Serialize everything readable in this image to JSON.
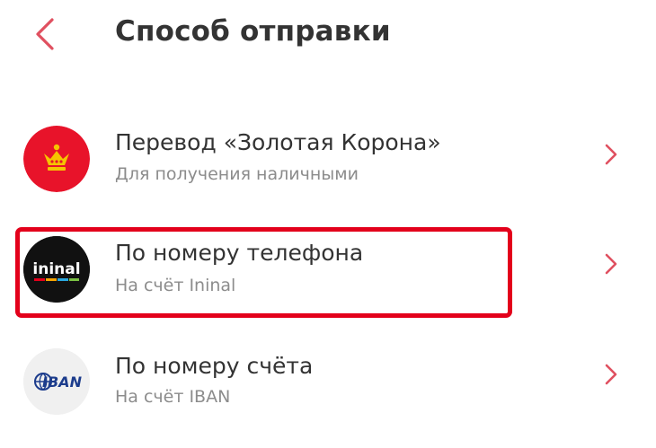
{
  "header": {
    "back_icon": "chevron-left-icon",
    "title": "Способ отправки"
  },
  "colors": {
    "accent": "#e3001b",
    "crown_red": "#e8132a",
    "crown_gold": "#f5c400",
    "ininal_bg": "#111111",
    "iban_bg": "#f0f0f0",
    "iban_blue": "#1c3c8c",
    "chevron": "#e05060"
  },
  "methods": [
    {
      "icon": "zolotaya-korona-logo",
      "title": "Перевод «Золотая Корона»",
      "subtitle": "Для получения наличными",
      "chevron_icon": "chevron-right-icon"
    },
    {
      "icon": "ininal-logo",
      "logo_text": "ininal",
      "title": "По номеру телефона",
      "subtitle": "На счёт Ininal",
      "chevron_icon": "chevron-right-icon",
      "highlighted": true
    },
    {
      "icon": "iban-logo",
      "logo_text": "IBAN",
      "title": "По номеру счёта",
      "subtitle": "На счёт IBAN",
      "chevron_icon": "chevron-right-icon"
    }
  ]
}
